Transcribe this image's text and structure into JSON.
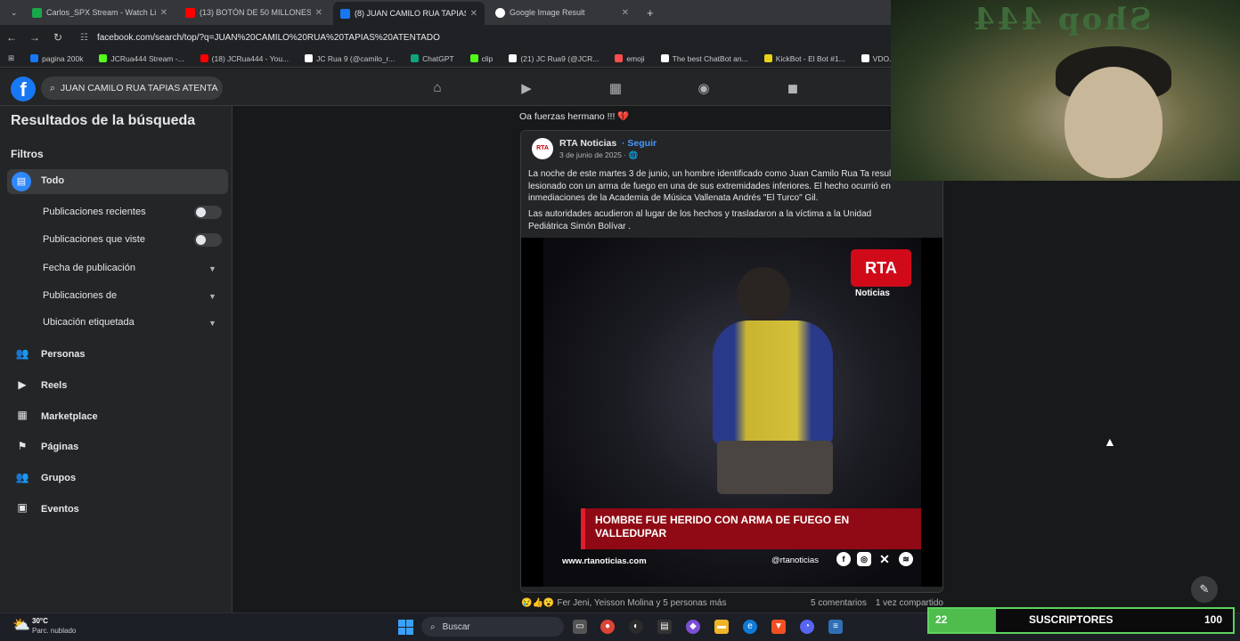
{
  "browser": {
    "tabs": [
      {
        "title": "Carlos_SPX Stream - Watch Live",
        "color": "#1aa64a",
        "active": false
      },
      {
        "title": "(13) BOTÓN DE 50 MILLONES",
        "color": "#ff0000",
        "active": false
      },
      {
        "title": "(8) JUAN CAMILO RUA TAPIAS",
        "color": "#1877f2",
        "active": true
      },
      {
        "title": "Google Image Result",
        "color": "#ffffff",
        "active": false
      }
    ],
    "url": "facebook.com/search/top/?q=JUAN%20CAMILO%20RUA%20TAPIAS%20ATENTADO",
    "bookmarks": [
      {
        "label": "pagina 200k",
        "color": "#1877f2"
      },
      {
        "label": "JCRua444 Stream -...",
        "color": "#53fc18"
      },
      {
        "label": "(18) JCRua444 - You...",
        "color": "#ff0000"
      },
      {
        "label": "JC Rua 9 (@camilo_r...",
        "color": "#ffffff"
      },
      {
        "label": "ChatGPT",
        "color": "#10a37f"
      },
      {
        "label": "clip",
        "color": "#53fc18"
      },
      {
        "label": "(21) JC Rua9 (@JCR...",
        "color": "#ffffff"
      },
      {
        "label": "emoji",
        "color": "#ff4d4d"
      },
      {
        "label": "The best ChatBot an...",
        "color": "#ffffff"
      },
      {
        "label": "KickBot - El Bot #1...",
        "color": "#e8d21a"
      },
      {
        "label": "VDO.Ninja",
        "color": "#ffffff"
      }
    ]
  },
  "fb": {
    "logo": "f",
    "search_value": "JUAN CAMILO RUA TAPIAS ATENTA",
    "nav_icons": [
      "home-icon",
      "video-icon",
      "marketplace-icon",
      "groups-icon",
      "gaming-icon"
    ]
  },
  "sidebar": {
    "title": "Resultados de la búsqueda",
    "filters_label": "Filtros",
    "all_label": "Todo",
    "toggles": [
      {
        "label": "Publicaciones recientes",
        "on": false
      },
      {
        "label": "Publicaciones que viste",
        "on": false
      }
    ],
    "dropdowns": [
      "Fecha de publicación",
      "Publicaciones de",
      "Ubicación etiquetada"
    ],
    "items": [
      {
        "label": "Personas",
        "icon": "people-icon"
      },
      {
        "label": "Reels",
        "icon": "reels-icon"
      },
      {
        "label": "Marketplace",
        "icon": "marketplace-icon"
      },
      {
        "label": "Páginas",
        "icon": "flag-icon"
      },
      {
        "label": "Grupos",
        "icon": "groups-icon"
      },
      {
        "label": "Eventos",
        "icon": "calendar-icon"
      }
    ]
  },
  "post": {
    "top_comment": "Oa fuerzas hermano !!! 💔",
    "avatar_text": "RTA",
    "author": "RTA Noticias",
    "follow": "· Seguir",
    "date": "3 de junio de 2025 · 🌐",
    "text1": "La noche de este martes 3 de junio, un hombre identificado como Juan Camilo Rua Ta resultó lesionado con un arma de fuego en una de sus extremidades inferiores. El hecho ocurrió en inmediaciones de la Academia de Música Vallenata Andrés \"El Turco\" Gil.",
    "text2": "Las autoridades acudieron al lugar de los hechos y trasladaron a la víctima a la Unidad Pediátrica Simón Bolívar .",
    "video": {
      "logo": "RTA",
      "logo_sub": "Noticias",
      "headline": "HOMBRE FUE HERIDO CON ARMA DE FUEGO EN VALLEDUPAR",
      "site": "www.rtanoticias.com",
      "handle": "@rtanoticias"
    },
    "reactions": "😢👍😮",
    "reactors": "Fer Jeni, Yeisson Molina y 5 personas más",
    "comments": "5 comentarios",
    "shares": "1 vez compartido"
  },
  "overlay": {
    "cam_text": "Shop 444",
    "subs_count": "22",
    "subs_label": "SUSCRIPTORES",
    "subs_goal": "100",
    "subs_progress": 0.22
  },
  "taskbar": {
    "temp": "30°C",
    "weather": "Parc. nublado",
    "search": "Buscar"
  }
}
